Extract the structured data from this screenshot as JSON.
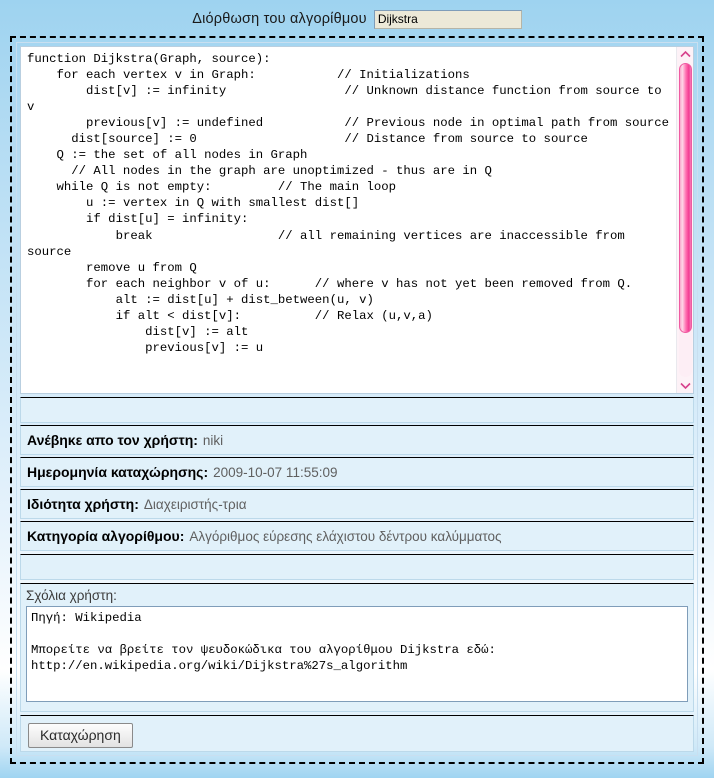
{
  "header": {
    "title": "Διόρθωση του αλγορίθμου",
    "algorithm_name_value": "Dijkstra",
    "algorithm_name_placeholder": ""
  },
  "code": {
    "value": "function Dijkstra(Graph, source):\n    for each vertex v in Graph:           // Initializations\n        dist[v] := infinity                // Unknown distance function from source to v\n        previous[v] := undefined           // Previous node in optimal path from source\n      dist[source] := 0                    // Distance from source to source\n    Q := the set of all nodes in Graph\n      // All nodes in the graph are unoptimized - thus are in Q\n    while Q is not empty:         // The main loop\n        u := vertex in Q with smallest dist[]\n        if dist[u] = infinity:\n            break                 // all remaining vertices are inaccessible from source\n        remove u from Q\n        for each neighbor v of u:      // where v has not yet been removed from Q.\n            alt := dist[u] + dist_between(u, v)\n            if alt < dist[v]:          // Relax (u,v,a)\n                dist[v] := alt\n                previous[v] := u"
  },
  "meta": [
    {
      "label": "Ανέβηκε απο τον χρήστη:",
      "value": "niki",
      "name": "uploaded-by"
    },
    {
      "label": "Ημερομηνία καταχώρησης:",
      "value": "2009-10-07 11:55:09",
      "name": "submission-date"
    },
    {
      "label": "Ιδιότητα χρήστη:",
      "value": "Διαχειριστής-τρια",
      "name": "user-role"
    },
    {
      "label": "Κατηγορία αλγορίθμου:",
      "value": "Αλγόριθμος εύρεσης ελάχιστου δέντρου καλύμματος",
      "name": "algorithm-category"
    }
  ],
  "comments": {
    "label": "Σχόλια χρήστη:",
    "value": "Πηγή: Wikipedia\n\nΜπορείτε να βρείτε τον ψευδοκώδικα του αλγορίθμου Dijkstra εδώ:\nhttp://en.wikipedia.org/wiki/Dijkstra%27s_algorithm"
  },
  "footer": {
    "submit_label": "Καταχώρηση"
  },
  "colors": {
    "page_background_top": "#9ed3f0",
    "row_background": "#e1f1fa",
    "scrollbar_accent": "#f23d93",
    "input_background": "#ece9d8",
    "value_text": "#5f5f5f"
  }
}
